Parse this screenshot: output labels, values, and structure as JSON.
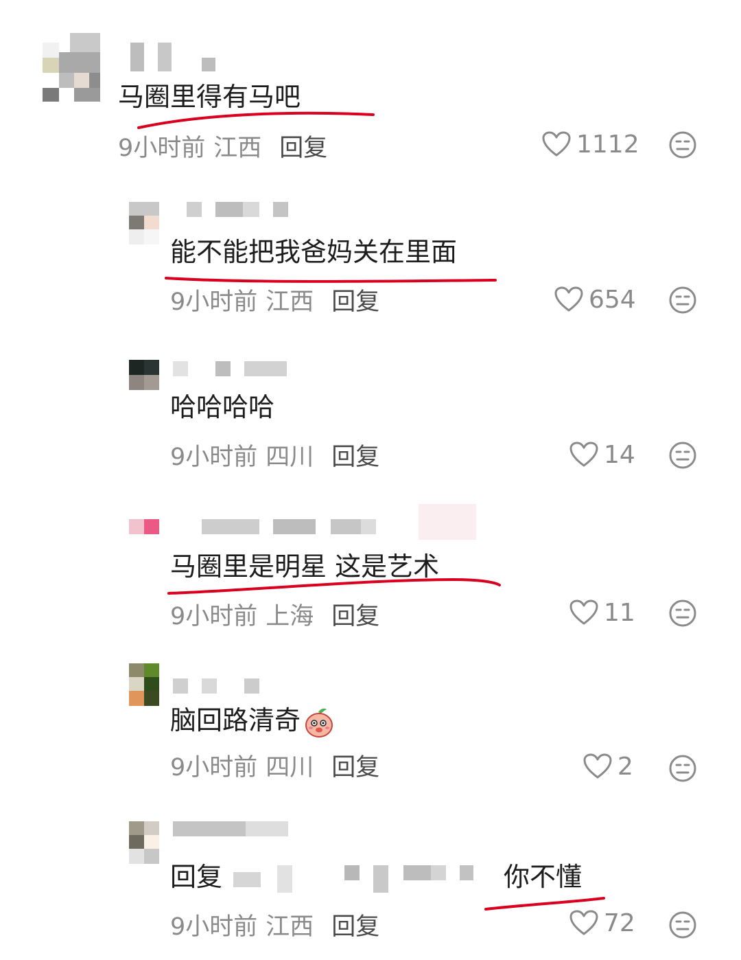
{
  "comments": [
    {
      "text": "马圈里得有马吧",
      "time": "9小时前",
      "location": "江西",
      "reply_label": "回复",
      "likes": "1112",
      "icons": {
        "like": "heart-icon",
        "dislike": "dislike-face-icon"
      }
    },
    {
      "text": "能不能把我爸妈关在里面",
      "time": "9小时前",
      "location": "江西",
      "reply_label": "回复",
      "likes": "654"
    },
    {
      "text": "哈哈哈哈",
      "time": "9小时前",
      "location": "四川",
      "reply_label": "回复",
      "likes": "14"
    },
    {
      "text": "马圈里是明星 这是艺术",
      "time": "9小时前",
      "location": "上海",
      "reply_label": "回复",
      "likes": "11"
    },
    {
      "text": "脑回路清奇",
      "emoji": "peach-emoji",
      "time": "9小时前",
      "location": "四川",
      "reply_label": "回复",
      "likes": "2"
    },
    {
      "text_prefix": "回复",
      "text": "你不懂",
      "time": "9小时前",
      "location": "江西",
      "reply_label": "回复",
      "likes": "72"
    }
  ],
  "colors": {
    "annotation_red": "#d8001e",
    "meta_gray": "#8a8a8a"
  }
}
